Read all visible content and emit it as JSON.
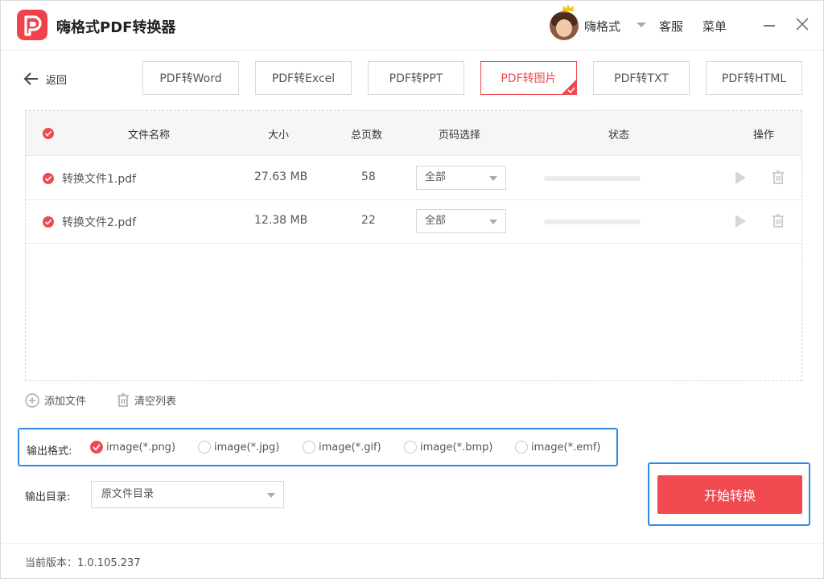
{
  "app": {
    "title": "嗨格式PDF转换器",
    "brand_color": "#f0424a",
    "accent_color": "#ef4a4f",
    "highlight_color": "#2f8ae6"
  },
  "header": {
    "username": "嗨格式",
    "service": "客服",
    "menu": "菜单"
  },
  "nav": {
    "back_label": "返回"
  },
  "tabs": [
    {
      "label": "PDF转Word",
      "active": false
    },
    {
      "label": "PDF转Excel",
      "active": false
    },
    {
      "label": "PDF转PPT",
      "active": false
    },
    {
      "label": "PDF转图片",
      "active": true
    },
    {
      "label": "PDF转TXT",
      "active": false
    },
    {
      "label": "PDF转HTML",
      "active": false
    }
  ],
  "table": {
    "columns": {
      "name": "文件名称",
      "size": "大小",
      "pages": "总页数",
      "page_select": "页码选择",
      "status": "状态",
      "actions": "操作"
    },
    "rows": [
      {
        "name": "转换文件1.pdf",
        "size": "27.63 MB",
        "pages": "58",
        "page_select": "全部",
        "progress": 0
      },
      {
        "name": "转换文件2.pdf",
        "size": "12.38 MB",
        "pages": "22",
        "page_select": "全部",
        "progress": 0
      }
    ]
  },
  "list_actions": {
    "add": "添加文件",
    "clear": "清空列表"
  },
  "output_format": {
    "label": "输出格式:",
    "options": [
      {
        "label": "image(*.png)",
        "selected": true
      },
      {
        "label": "image(*.jpg)",
        "selected": false
      },
      {
        "label": "image(*.gif)",
        "selected": false
      },
      {
        "label": "image(*.bmp)",
        "selected": false
      },
      {
        "label": "image(*.emf)",
        "selected": false
      }
    ]
  },
  "output_dir": {
    "label": "输出目录:",
    "value": "原文件目录"
  },
  "start_button": "开始转换",
  "footer": {
    "version": "当前版本：1.0.105.237"
  }
}
